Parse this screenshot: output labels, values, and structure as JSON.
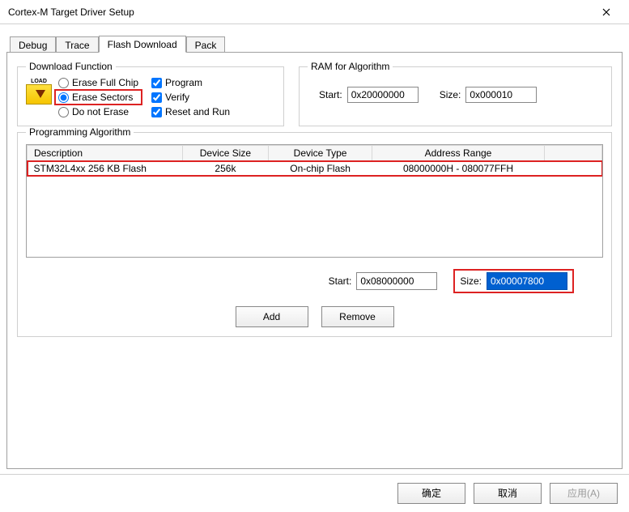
{
  "window": {
    "title": "Cortex-M Target Driver Setup"
  },
  "tabs": {
    "debug": "Debug",
    "trace": "Trace",
    "flash": "Flash Download",
    "pack": "Pack"
  },
  "downloadFunction": {
    "legend": "Download Function",
    "radios": {
      "eraseFull": "Erase Full Chip",
      "eraseSectors": "Erase Sectors",
      "doNotErase": "Do not Erase"
    },
    "checks": {
      "program": "Program",
      "verify": "Verify",
      "resetRun": "Reset and Run"
    }
  },
  "ram": {
    "legend": "RAM for Algorithm",
    "startLabel": "Start:",
    "startValue": "0x20000000",
    "sizeLabel": "Size:",
    "sizeValue": "0x000010"
  },
  "progAlgo": {
    "legend": "Programming Algorithm",
    "headers": {
      "desc": "Description",
      "devSize": "Device Size",
      "devType": "Device Type",
      "addrRange": "Address Range"
    },
    "row": {
      "desc": "STM32L4xx 256 KB Flash",
      "devSize": "256k",
      "devType": "On-chip Flash",
      "addrRange": "08000000H - 080077FFH"
    },
    "startLabel": "Start:",
    "startValue": "0x08000000",
    "sizeLabel": "Size:",
    "sizeValue": "0x00007800",
    "addBtn": "Add",
    "removeBtn": "Remove"
  },
  "buttons": {
    "ok": "确定",
    "cancel": "取消",
    "apply": "应用(A)"
  }
}
